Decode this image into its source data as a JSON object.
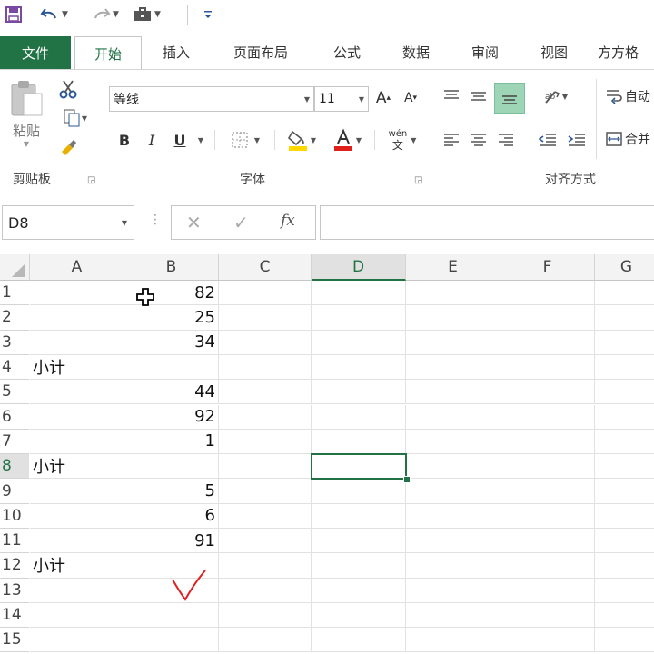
{
  "quick_access": {
    "save_icon": "save-icon",
    "undo_icon": "undo-icon",
    "redo_icon": "redo-icon",
    "briefcase_icon": "briefcase-icon",
    "customize_icon": "customize-icon"
  },
  "tabs": [
    {
      "label": "文件"
    },
    {
      "label": "开始"
    },
    {
      "label": "插入"
    },
    {
      "label": "页面布局"
    },
    {
      "label": "公式"
    },
    {
      "label": "数据"
    },
    {
      "label": "审阅"
    },
    {
      "label": "视图"
    },
    {
      "label": "方方格"
    }
  ],
  "ribbon": {
    "clipboard": {
      "paste_label": "粘贴",
      "group_label": "剪贴板"
    },
    "font": {
      "font_name": "等线",
      "font_size": "11",
      "group_label": "字体",
      "bold": "B",
      "italic": "I",
      "underline": "U",
      "phonetic_top": "wén",
      "phonetic_bottom": "文",
      "fill_color": "#ffd800",
      "font_color": "#e0201a"
    },
    "alignment": {
      "group_label": "对齐方式",
      "wrap_label": "自动",
      "merge_label": "合并"
    }
  },
  "formula_bar": {
    "name_box": "D8",
    "fx": "fx",
    "formula": ""
  },
  "sheet": {
    "columns": [
      "A",
      "B",
      "C",
      "D",
      "E",
      "F",
      "G"
    ],
    "selected_column": "D",
    "selected_row": "8",
    "rows": [
      {
        "num": "1",
        "A": "",
        "B": "82"
      },
      {
        "num": "2",
        "A": "",
        "B": "25"
      },
      {
        "num": "3",
        "A": "",
        "B": "34"
      },
      {
        "num": "4",
        "A": "小计",
        "B": ""
      },
      {
        "num": "5",
        "A": "",
        "B": "44"
      },
      {
        "num": "6",
        "A": "",
        "B": "92"
      },
      {
        "num": "7",
        "A": "",
        "B": "1"
      },
      {
        "num": "8",
        "A": "小计",
        "B": ""
      },
      {
        "num": "9",
        "A": "",
        "B": "5"
      },
      {
        "num": "10",
        "A": "",
        "B": "6"
      },
      {
        "num": "11",
        "A": "",
        "B": "91"
      },
      {
        "num": "12",
        "A": "小计",
        "B": ""
      },
      {
        "num": "13",
        "A": "",
        "B": ""
      },
      {
        "num": "14",
        "A": "",
        "B": ""
      },
      {
        "num": "15",
        "A": "",
        "B": ""
      }
    ]
  },
  "colors": {
    "accent": "#217346",
    "annotation": "#e02020"
  }
}
